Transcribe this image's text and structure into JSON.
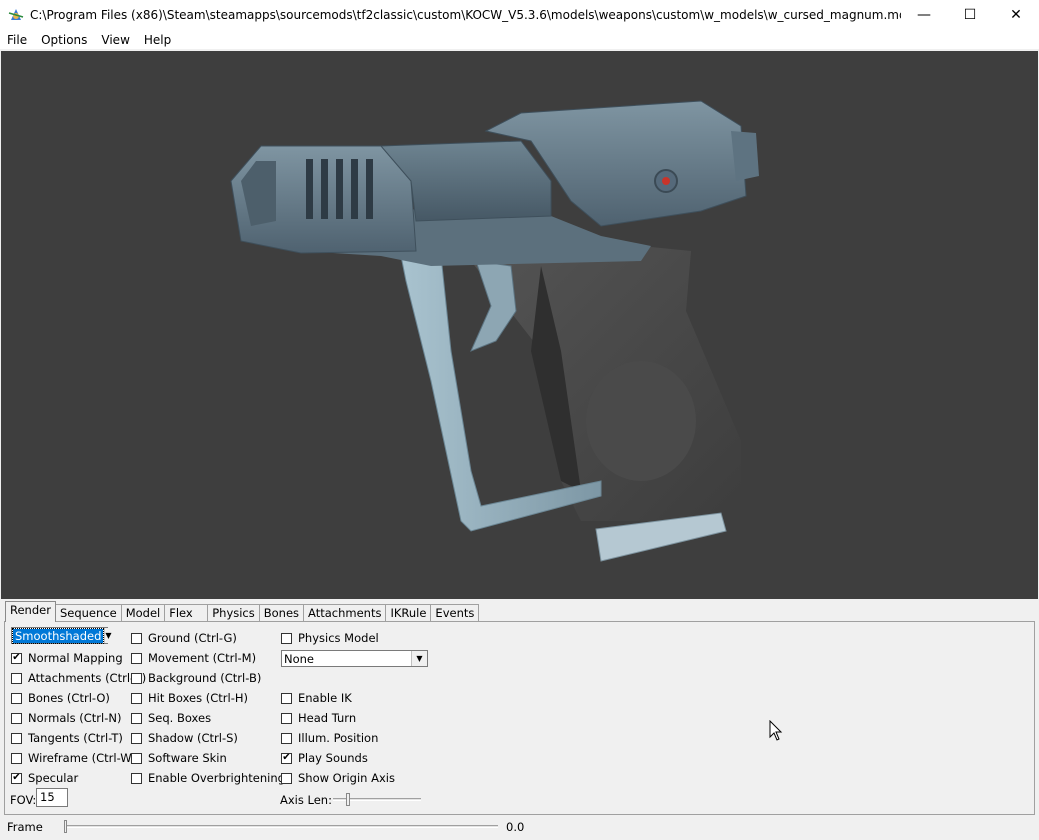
{
  "window": {
    "title": "C:\\Program Files (x86)\\Steam\\steamapps\\sourcemods\\tf2classic\\custom\\KOCW_V5.3.6\\models\\weapons\\custom\\w_models\\w_cursed_magnum.mdl",
    "minimize": "—",
    "maximize": "☐",
    "close": "✕"
  },
  "menu": {
    "file": "File",
    "options": "Options",
    "view": "View",
    "help": "Help"
  },
  "tabs": [
    "Render",
    "Sequence",
    "Model",
    "Flex",
    "Physics",
    "Bones",
    "Attachments",
    "IKRule",
    "Events"
  ],
  "render": {
    "render_mode": "Smoothshaded",
    "col1": [
      {
        "label": "Normal Mapping",
        "checked": true
      },
      {
        "label": "Attachments (Ctrl-A)",
        "checked": false
      },
      {
        "label": "Bones (Ctrl-O)",
        "checked": false
      },
      {
        "label": "Normals (Ctrl-N)",
        "checked": false
      },
      {
        "label": "Tangents (Ctrl-T)",
        "checked": false
      },
      {
        "label": "Wireframe (Ctrl-W)",
        "checked": false
      },
      {
        "label": "Specular",
        "checked": true
      }
    ],
    "col2": [
      {
        "label": "Ground (Ctrl-G)",
        "checked": false
      },
      {
        "label": "Movement (Ctrl-M)",
        "checked": false
      },
      {
        "label": "Background (Ctrl-B)",
        "checked": false
      },
      {
        "label": "Hit Boxes (Ctrl-H)",
        "checked": false
      },
      {
        "label": "Seq. Boxes",
        "checked": false
      },
      {
        "label": "Shadow (Ctrl-S)",
        "checked": false
      },
      {
        "label": "Software Skin",
        "checked": false
      },
      {
        "label": "Enable Overbrightening",
        "checked": false
      }
    ],
    "physics_model": {
      "label": "Physics Model",
      "checked": false
    },
    "physics_select": "None",
    "col3": [
      {
        "label": "Enable IK",
        "checked": false
      },
      {
        "label": "Head Turn",
        "checked": false
      },
      {
        "label": "Illum. Position",
        "checked": false
      },
      {
        "label": "Play Sounds",
        "checked": true
      },
      {
        "label": "Show Origin Axis",
        "checked": false
      }
    ],
    "fov_label": "FOV:",
    "fov_value": "15",
    "axis_len_label": "Axis Len:"
  },
  "status": {
    "frame_label": "Frame",
    "frame_value": "0.0"
  },
  "check_glyph": "✔"
}
